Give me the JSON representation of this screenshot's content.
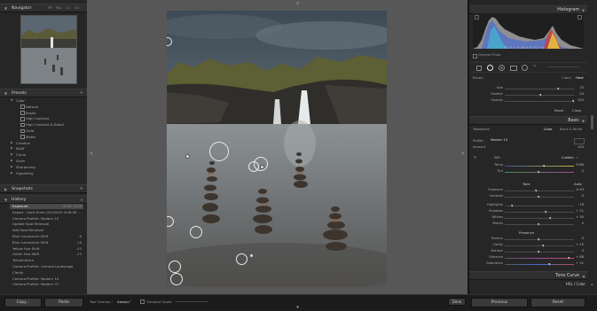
{
  "left": {
    "navigator": {
      "title": "Navigator",
      "zoom": [
        "FIT",
        "FILL",
        "1:1",
        "3:1"
      ]
    },
    "presets": {
      "title": "Presets",
      "items": [
        {
          "label": "Color",
          "kind": "folder"
        },
        {
          "label": "Natural",
          "kind": "preset"
        },
        {
          "label": "Bright",
          "kind": "preset"
        },
        {
          "label": "High Contrast",
          "kind": "preset"
        },
        {
          "label": "High Contrast & Detail",
          "kind": "preset"
        },
        {
          "label": "Vivid",
          "kind": "preset"
        },
        {
          "label": "Matte",
          "kind": "preset"
        },
        {
          "label": "Creative",
          "kind": "folder"
        },
        {
          "label": "B&W",
          "kind": "folder"
        },
        {
          "label": "Curve",
          "kind": "folder"
        },
        {
          "label": "Grain",
          "kind": "folder"
        },
        {
          "label": "Sharpening",
          "kind": "folder"
        },
        {
          "label": "Vignetting",
          "kind": "folder"
        }
      ]
    },
    "snapshots": {
      "title": "Snapshots"
    },
    "history": {
      "title": "History",
      "items": [
        {
          "label": "Exposure",
          "a": "-0.16",
          "b": "-0.43",
          "selected": true
        },
        {
          "label": "Export - Hard Drive (5/1/2020 4:08:48 ...",
          "a": "",
          "b": "",
          "selected": false
        },
        {
          "label": "Camera Profiler: Modern 10",
          "a": "",
          "b": "",
          "selected": false
        },
        {
          "label": "Update Spot Removal",
          "a": "",
          "b": "",
          "selected": false
        },
        {
          "label": "Add Spot Removal",
          "a": "",
          "b": "",
          "selected": false
        },
        {
          "label": "Blue Luminance Shift",
          "a": "",
          "b": "-8",
          "selected": false
        },
        {
          "label": "Blue Luminance Shift",
          "a": "",
          "b": "-16",
          "selected": false
        },
        {
          "label": "Yellow Hue Shift",
          "a": "",
          "b": "-45",
          "selected": false
        },
        {
          "label": "Green Hue Shift",
          "a": "",
          "b": "-23",
          "selected": false
        },
        {
          "label": "Temperature",
          "a": "",
          "b": "",
          "selected": false
        },
        {
          "label": "Camera Profiler: Camera Landscape",
          "a": "",
          "b": "",
          "selected": false
        },
        {
          "label": "Clarity",
          "a": "",
          "b": "",
          "selected": false
        },
        {
          "label": "Camera Profiler: Modern 10",
          "a": "",
          "b": "",
          "selected": false
        },
        {
          "label": "Camera Profiler: Modern 07",
          "a": "",
          "b": "",
          "selected": false
        }
      ]
    },
    "copy_label": "Copy...",
    "paste_label": "Paste"
  },
  "toolbar": {
    "tool_overlay_label": "Tool Overlay :",
    "tool_overlay_value": "Always",
    "visualize_spots_label": "Visualize Spots",
    "done_label": "Done"
  },
  "right": {
    "histogram": {
      "title": "Histogram",
      "readout": [
        "37.3",
        "38.3",
        "37.7"
      ],
      "original_photo": "Original Photo"
    },
    "brush": {
      "label": "Brush :",
      "modes": [
        "Clone",
        "Heal"
      ],
      "active_mode": "Heal",
      "sliders": [
        {
          "label": "Size",
          "value": "75",
          "pos": 0.78
        },
        {
          "label": "Feather",
          "value": "53",
          "pos": 0.53
        },
        {
          "label": "Opacity",
          "value": "100",
          "pos": 1.0
        }
      ],
      "reset_label": "Reset",
      "close_label": "Close"
    },
    "basic": {
      "title": "Basic",
      "treatment_label": "Treatment :",
      "treatment_options": [
        "Color",
        "Black & White"
      ],
      "profile_label": "Profile :",
      "profile_value": "Modern 10",
      "amount_label": "Amount",
      "amount_value": "100",
      "wb_label": "WB :",
      "wb_value": "Custom",
      "temp": {
        "label": "Temp",
        "value": "5766",
        "pos": 0.58
      },
      "tint": {
        "label": "Tint",
        "value": "0",
        "pos": 0.5
      },
      "tone_label": "Tone",
      "auto_label": "Auto",
      "tone_sliders": [
        {
          "label": "Exposure",
          "value": "-0.43",
          "pos": 0.46
        },
        {
          "label": "Contrast",
          "value": "0",
          "pos": 0.5
        },
        {
          "label": "Highlights",
          "value": "-78",
          "pos": 0.11
        },
        {
          "label": "Shadows",
          "value": "+ 21",
          "pos": 0.6
        },
        {
          "label": "Whites",
          "value": "+ 35",
          "pos": 0.67
        },
        {
          "label": "Blacks",
          "value": "0",
          "pos": 0.5
        }
      ],
      "presence_label": "Presence",
      "presence_sliders": [
        {
          "label": "Texture",
          "value": "0",
          "pos": 0.5
        },
        {
          "label": "Clarity",
          "value": "+ 15",
          "pos": 0.57
        },
        {
          "label": "Dehaze",
          "value": "0",
          "pos": 0.5
        },
        {
          "label": "Vibrance",
          "value": "+ 88",
          "pos": 0.94
        },
        {
          "label": "Saturation",
          "value": "+ 31",
          "pos": 0.65
        }
      ]
    },
    "tone_curve": {
      "title": "Tone Curve"
    },
    "hsl": {
      "label": "HSL / Color"
    },
    "previous_label": "Previous",
    "reset_label": "Reset"
  },
  "colors": {
    "panel": "#262626",
    "canvas": "#575757",
    "accent": "#cfcfcf"
  }
}
